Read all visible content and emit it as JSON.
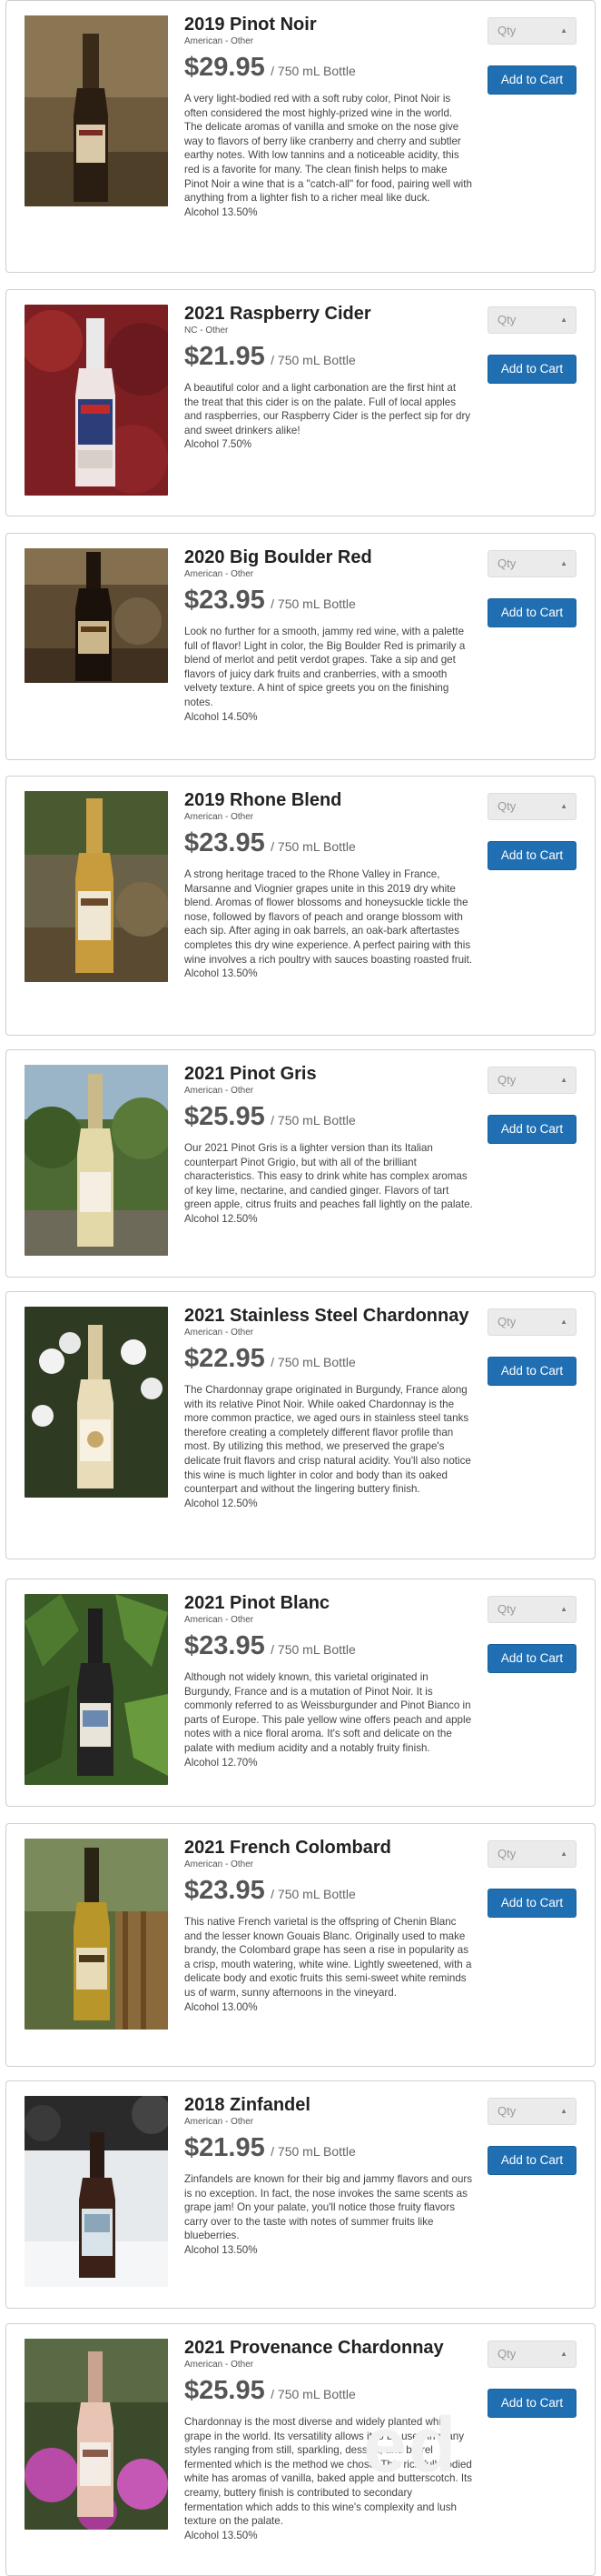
{
  "ui": {
    "qty_placeholder": "Qty",
    "add_to_cart_label": "Add to Cart",
    "watermark_text": "ed"
  },
  "products": [
    {
      "name": "2019 Pinot Noir",
      "region": "American - Other",
      "price": "$29.95",
      "size": "/ 750 mL Bottle",
      "description": "A very light-bodied red with a soft ruby color, Pinot Noir is often considered the most highly-prized wine in the world. The delicate aromas of vanilla and smoke on the nose give way to flavors of berry like cranberry and cherry and subtler earthy notes. With low tannins and a noticeable acidity, this red is a favorite for many. The clean finish helps to make Pinot Noir a wine that is a \"catch-all\" for food, pairing well with anything from a lighter fish to a richer meal like duck.",
      "alcohol": "Alcohol 13.50%"
    },
    {
      "name": "2021 Raspberry Cider",
      "region": "NC - Other",
      "price": "$21.95",
      "size": "/ 750 mL Bottle",
      "description": "A beautiful color and a light carbonation are the first hint at the treat that this cider is on the palate. Full of local apples and raspberries, our Raspberry Cider is the perfect sip for dry and sweet drinkers alike!",
      "alcohol": "Alcohol 7.50%"
    },
    {
      "name": "2020 Big Boulder Red",
      "region": "American - Other",
      "price": "$23.95",
      "size": "/ 750 mL Bottle",
      "description": "Look no further for a smooth, jammy red wine, with a palette full of flavor! Light in color, the Big Boulder Red is primarily a blend of merlot and petit verdot grapes. Take a sip and get flavors of juicy dark fruits and cranberries, with a smooth velvety texture. A hint of spice greets you on the finishing notes.",
      "alcohol": "Alcohol 14.50%"
    },
    {
      "name": "2019 Rhone Blend",
      "region": "American - Other",
      "price": "$23.95",
      "size": "/ 750 mL Bottle",
      "description": "A strong heritage traced to the Rhone Valley in France, Marsanne and Viognier grapes unite in this 2019 dry white blend. Aromas of flower blossoms and honeysuckle tickle the nose, followed by flavors of peach and orange blossom with each sip. After aging in oak barrels, an oak-bark aftertastes completes this dry wine experience. A perfect pairing with this wine involves a rich poultry with sauces boasting roasted fruit.",
      "alcohol": "Alcohol 13.50%"
    },
    {
      "name": "2021 Pinot Gris",
      "region": "American - Other",
      "price": "$25.95",
      "size": "/ 750 mL Bottle",
      "description": "Our 2021 Pinot Gris is a lighter version than its Italian counterpart Pinot Grigio, but with all of the brilliant characteristics. This easy to drink white has complex aromas of key lime, nectarine, and candied ginger. Flavors of tart green apple, citrus fruits and peaches fall lightly on the palate.",
      "alcohol": "Alcohol 12.50%"
    },
    {
      "name": "2021 Stainless Steel Chardonnay",
      "region": "American - Other",
      "price": "$22.95",
      "size": "/ 750 mL Bottle",
      "description": "The Chardonnay grape originated in Burgundy, France along with its relative Pinot Noir. While oaked Chardonnay is the more common practice, we aged ours in stainless steel tanks therefore creating a completely different flavor profile than most. By utilizing this method, we preserved the grape's delicate fruit flavors and crisp natural acidity. You'll also notice this wine is much lighter in color and body than its oaked counterpart and without the lingering buttery finish.",
      "alcohol": "Alcohol 12.50%"
    },
    {
      "name": "2021 Pinot Blanc",
      "region": "American - Other",
      "price": "$23.95",
      "size": "/ 750 mL Bottle",
      "description": "Although not widely known, this varietal originated in Burgundy, France and is a mutation of Pinot Noir. It is commonly referred to as Weissburgunder and Pinot Bianco in parts of Europe. This pale yellow wine offers peach and apple notes with a nice floral aroma. It's soft and delicate on the palate with medium acidity and a notably fruity finish.",
      "alcohol": "Alcohol 12.70%"
    },
    {
      "name": "2021 French Colombard",
      "region": "American - Other",
      "price": "$23.95",
      "size": "/ 750 mL Bottle",
      "description": "This native French varietal is the offspring of Chenin Blanc and the lesser known Gouais Blanc. Originally used to make brandy, the Colombard grape has seen a rise in popularity as a crisp, mouth watering, white wine. Lightly sweetened, with a delicate body and exotic fruits this semi-sweet white reminds us of warm, sunny afternoons in the vineyard.",
      "alcohol": "Alcohol 13.00%"
    },
    {
      "name": "2018 Zinfandel",
      "region": "American - Other",
      "price": "$21.95",
      "size": "/ 750 mL Bottle",
      "description": "Zinfandels are known for their big and jammy flavors and ours is no exception. In fact, the nose invokes the same scents as grape jam! On your palate, you'll notice those fruity flavors carry over to the taste with notes of summer fruits like blueberries.",
      "alcohol": "Alcohol 13.50%"
    },
    {
      "name": "2021 Provenance Chardonnay",
      "region": "American - Other",
      "price": "$25.95",
      "size": "/ 750 mL Bottle",
      "description": "Chardonnay is the most diverse and widely planted white grape in the world. Its versatility allows it to be used in many styles ranging from still, sparkling, dessert, and barrel fermented which is the method we chose. This rich full-bodied white has aromas of vanilla, baked apple and butterscotch. Its creamy, buttery finish is contributed to secondary fermentation which adds to this wine's complexity and lush texture on the palate.",
      "alcohol": "Alcohol 13.50%"
    }
  ]
}
